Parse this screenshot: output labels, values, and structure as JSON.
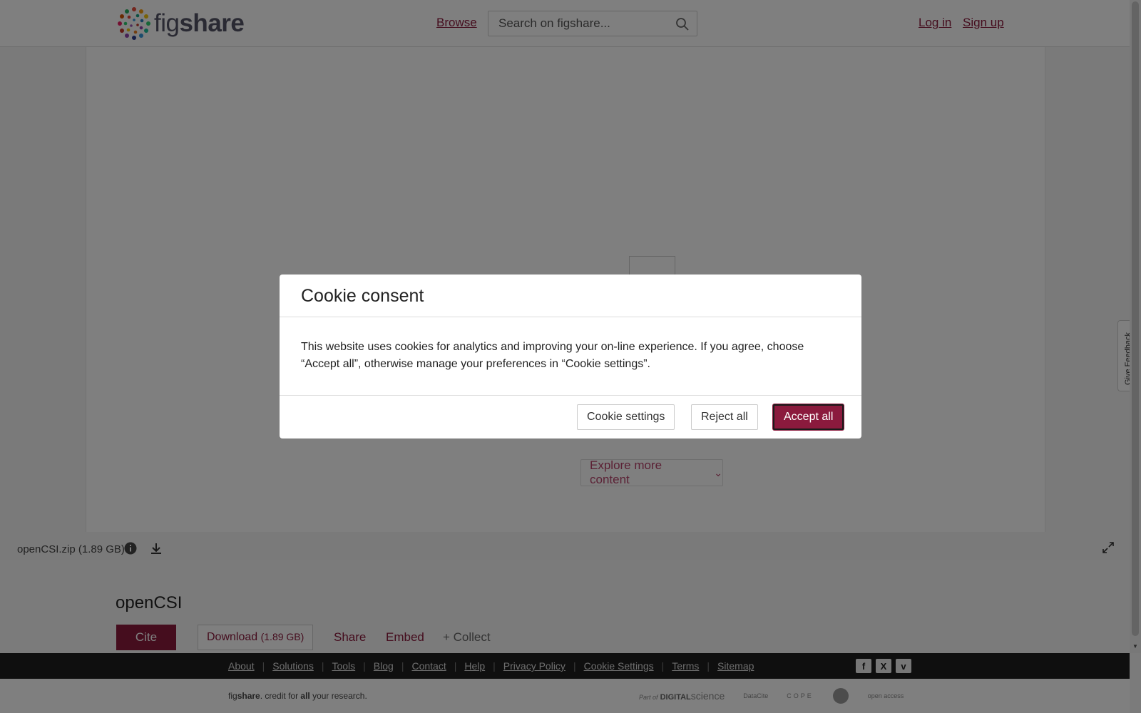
{
  "header": {
    "logo_text_fig": "fig",
    "logo_text_share": "share",
    "browse": "Browse",
    "search_placeholder": "Search on figshare...",
    "login": "Log in",
    "signup": "Sign up"
  },
  "viewer": {
    "explore": "Explore more content",
    "file_name": "openCSI.zip",
    "file_size": "(1.89 GB)"
  },
  "item": {
    "title": "openCSI",
    "cite": "Cite",
    "download": "Download",
    "download_size": "(1.89 GB)",
    "share": "Share",
    "embed": "Embed",
    "collect": "+ Collect"
  },
  "footer": {
    "links": [
      "About",
      "Solutions",
      "Tools",
      "Blog",
      "Contact",
      "Help",
      "Privacy Policy",
      "Cookie Settings",
      "Terms",
      "Sitemap"
    ],
    "social": [
      "f",
      "X",
      "v"
    ],
    "tagline_fig": "fig",
    "tagline_share": "share",
    "tagline_mid": ". credit for ",
    "tagline_all": "all",
    "tagline_end": " your research.",
    "partner_ds_prefix": "Part of",
    "partner_ds_digital": "DIGITAL",
    "partner_ds_science": "science",
    "partner_datacite": "DataCite",
    "partner_cope": "COPE",
    "partner_oa": "open access"
  },
  "feedback": "Give Feedback",
  "cookie_modal": {
    "title": "Cookie consent",
    "body": "This website uses cookies for analytics and improving your on-line experience. If you agree, choose “Accept all”, otherwise manage your preferences in “Cookie settings”.",
    "settings": "Cookie settings",
    "reject": "Reject all",
    "accept": "Accept all"
  },
  "colors": {
    "brand": "#8b1a3d",
    "overlay": "rgba(0,0,0,0.5)"
  },
  "icons": [
    "search-icon",
    "info-icon",
    "download-icon",
    "expand-icon",
    "facebook-icon",
    "x-icon",
    "vimeo-icon",
    "chevron-down-icon"
  ]
}
